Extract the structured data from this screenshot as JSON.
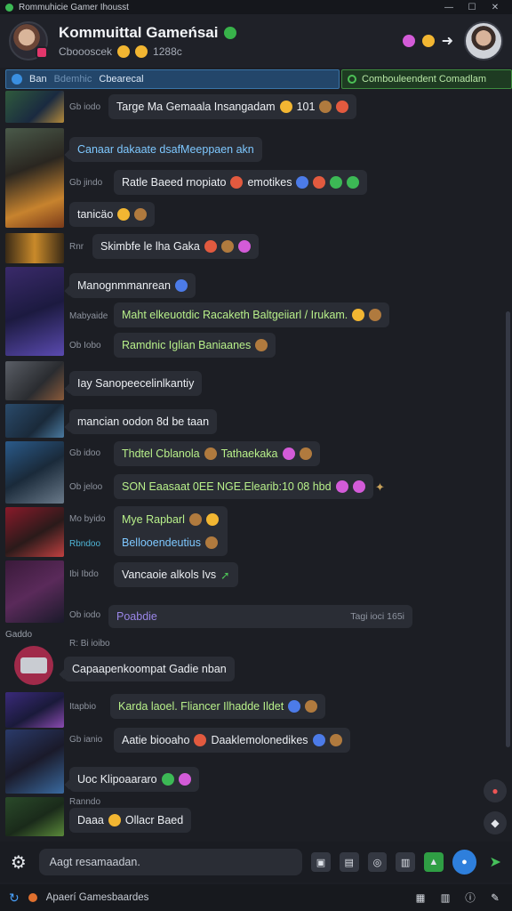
{
  "window": {
    "title": "Rommuhicie Gamer Ihousst",
    "minimize": "—",
    "maximize": "☐",
    "close": "✕"
  },
  "header": {
    "title": "Kommuittal Gameńsai",
    "subtitle": "Cboooscek",
    "count": "1288c"
  },
  "tabs": {
    "left_a": "Ban",
    "left_b": "Bdemhic",
    "left_c": "Cbearecal",
    "right": "Combouleendent Comadlam"
  },
  "messages": [
    {
      "nick": "Gb iodo",
      "text": "Targe Ma Gemaala Insangadam",
      "extra": "101",
      "style": ""
    },
    {
      "nick": "",
      "text": "Canaar dakaate dsafMeeppaen akn",
      "extra": "",
      "style": "blue"
    },
    {
      "nick": "Gb jindo",
      "text": "Ratle Baeed rnopiato",
      "extra": "emotikes",
      "style": ""
    },
    {
      "nick": "",
      "text": "tanicäo",
      "extra": "",
      "style": ""
    },
    {
      "nick": "Rnr",
      "text": "Skimbfe le lha Gaka",
      "extra": "",
      "style": ""
    },
    {
      "nick": "",
      "text": "Manognmmanrean",
      "extra": "",
      "style": ""
    },
    {
      "nick": "Mabyaide",
      "text": "Maht elkeuotdic Racaketh Baltgeiiarl / Irukam.",
      "extra": "",
      "style": "green"
    },
    {
      "nick": "Ob Iobo",
      "text": "Ramdnic Iglian Baniaanes",
      "extra": "",
      "style": "green"
    },
    {
      "nick": "",
      "text": "Iay Sanopeecelinlkantiy",
      "extra": "",
      "style": ""
    },
    {
      "nick": "",
      "text": "mancian oodon 8d be taan",
      "extra": "",
      "style": ""
    },
    {
      "nick": "Gb idoo",
      "text": "Thdtel Cblanola",
      "extra": "Tathaekaka",
      "style": "green"
    },
    {
      "nick": "Ob jeloo",
      "text": "SON Eaasaat 0EE NGE.Elearib:10 08 hbd",
      "extra": "",
      "style": "green"
    },
    {
      "nick": "Mo byido",
      "text": "Mye Rapbarl",
      "extra": "",
      "style": "green"
    },
    {
      "nick": "Rbndoo",
      "text": "Bellooendeutius",
      "extra": "",
      "style": "blue"
    },
    {
      "nick": "Ibi Ibdo",
      "text": "Vancaoie alkols Ivs",
      "extra": "",
      "style": ""
    },
    {
      "nick": "Ob iodo",
      "text": "Poabdie",
      "extra": "Tagi ioci 165i",
      "style": "purple"
    },
    {
      "nick": "R: Bi ioibo",
      "text": "Capaapenkoompat Gadie nban",
      "extra": "",
      "style": ""
    },
    {
      "nick": "Itapbio",
      "text": "Karda laoel. Fliancer Ilhadde Ildet",
      "extra": "",
      "style": "green"
    },
    {
      "nick": "Gb ianio",
      "text": "Aatie biooaho",
      "extra": "Daaklemolonedikes",
      "style": ""
    },
    {
      "nick": "",
      "text": "Uoc Klipoaararo",
      "extra": "",
      "style": ""
    },
    {
      "nick": "Ranndo",
      "text": "Daaa",
      "extra": "Ollacr Baed",
      "style": ""
    }
  ],
  "section_label": "Gaddo",
  "composer": {
    "placeholder": "Aagt resamaadan."
  },
  "statusbar": {
    "text": "Apaerí Gamesbaardes"
  }
}
